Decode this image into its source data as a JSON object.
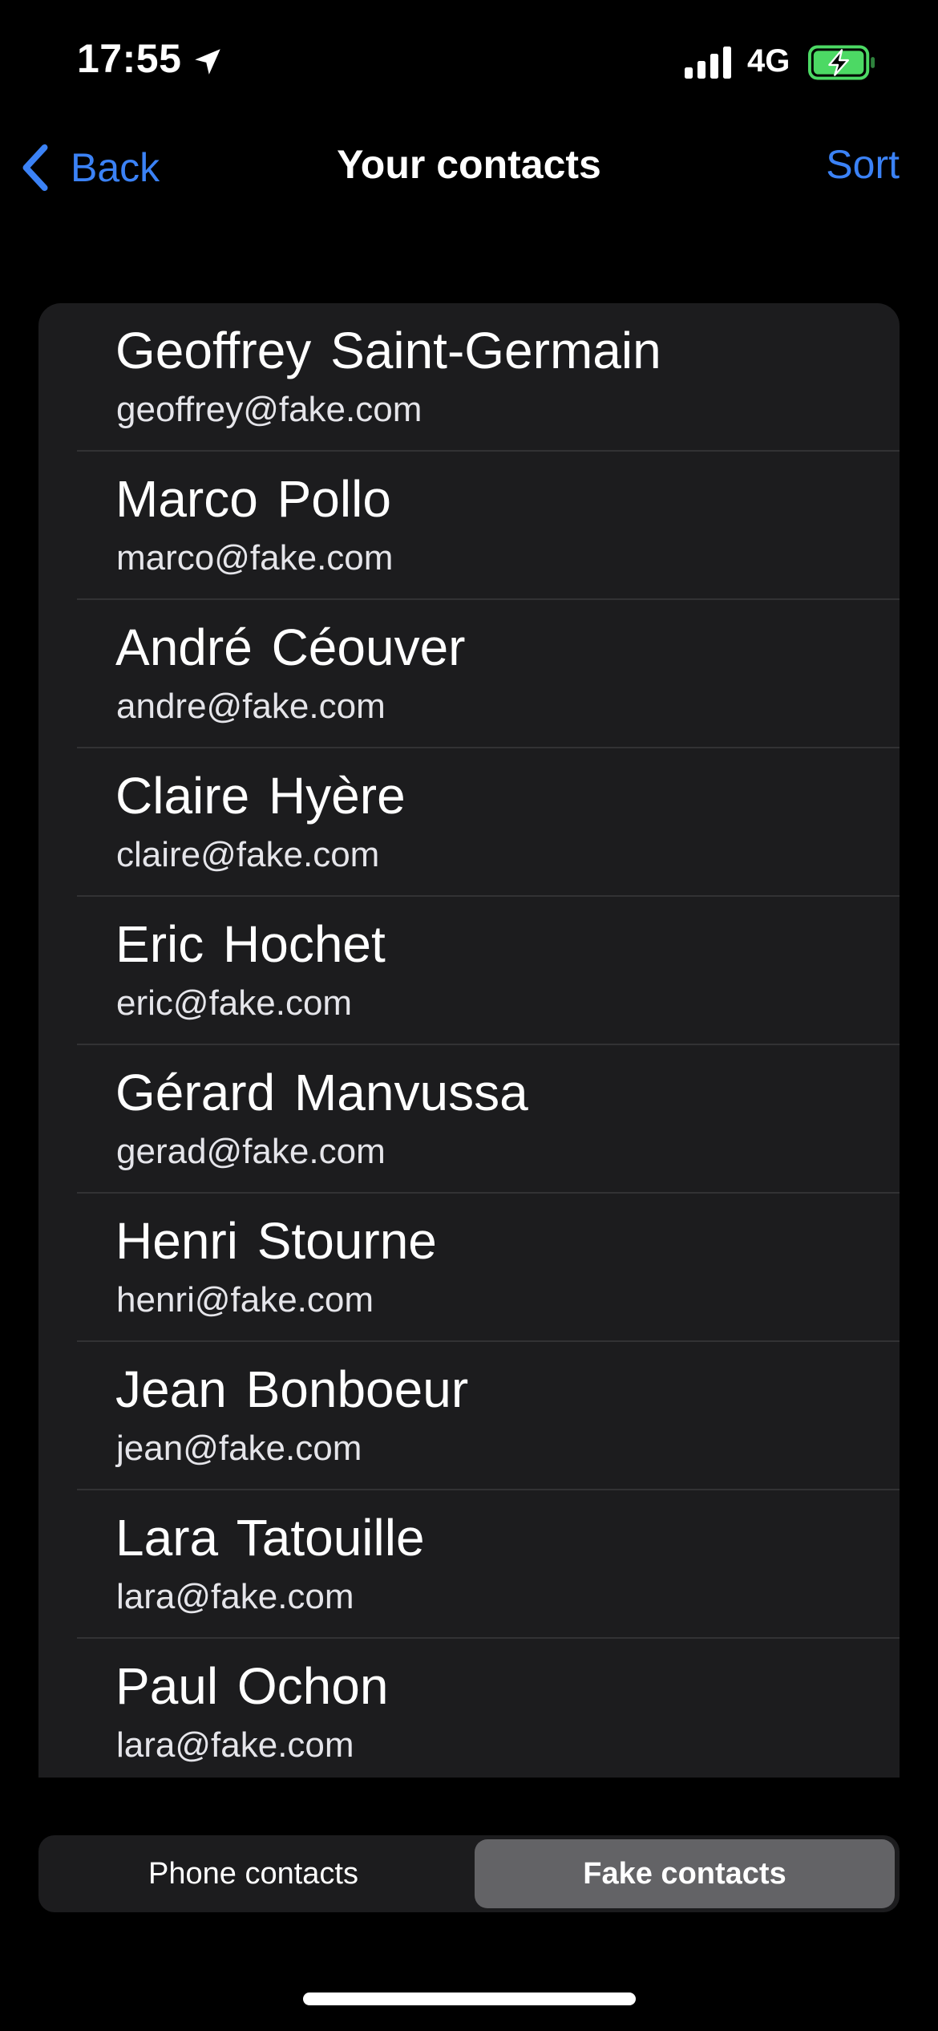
{
  "status_bar": {
    "time": "17:55",
    "network": "4G",
    "icons": [
      "location-arrow-icon",
      "cellular-signal-icon",
      "battery-charging-icon"
    ],
    "battery_color": "#4cd964"
  },
  "nav": {
    "back_label": "Back",
    "title": "Your contacts",
    "sort_label": "Sort",
    "accent_color": "#3b82f6"
  },
  "contacts": [
    {
      "name": "Geoffrey Saint-Germain",
      "email": "geoffrey@fake.com"
    },
    {
      "name": "Marco Pollo",
      "email": "marco@fake.com"
    },
    {
      "name": "André Céouver",
      "email": "andre@fake.com"
    },
    {
      "name": "Claire Hyère",
      "email": "claire@fake.com"
    },
    {
      "name": "Eric Hochet",
      "email": "eric@fake.com"
    },
    {
      "name": "Gérard Manvussa",
      "email": "gerad@fake.com"
    },
    {
      "name": "Henri Stourne",
      "email": "henri@fake.com"
    },
    {
      "name": "Jean Bonboeur",
      "email": "jean@fake.com"
    },
    {
      "name": "Lara Tatouille",
      "email": "lara@fake.com"
    },
    {
      "name": "Paul Ochon",
      "email": "lara@fake.com"
    }
  ],
  "segmented_control": {
    "options": [
      "Phone contacts",
      "Fake contacts"
    ],
    "selected": "Fake contacts"
  }
}
